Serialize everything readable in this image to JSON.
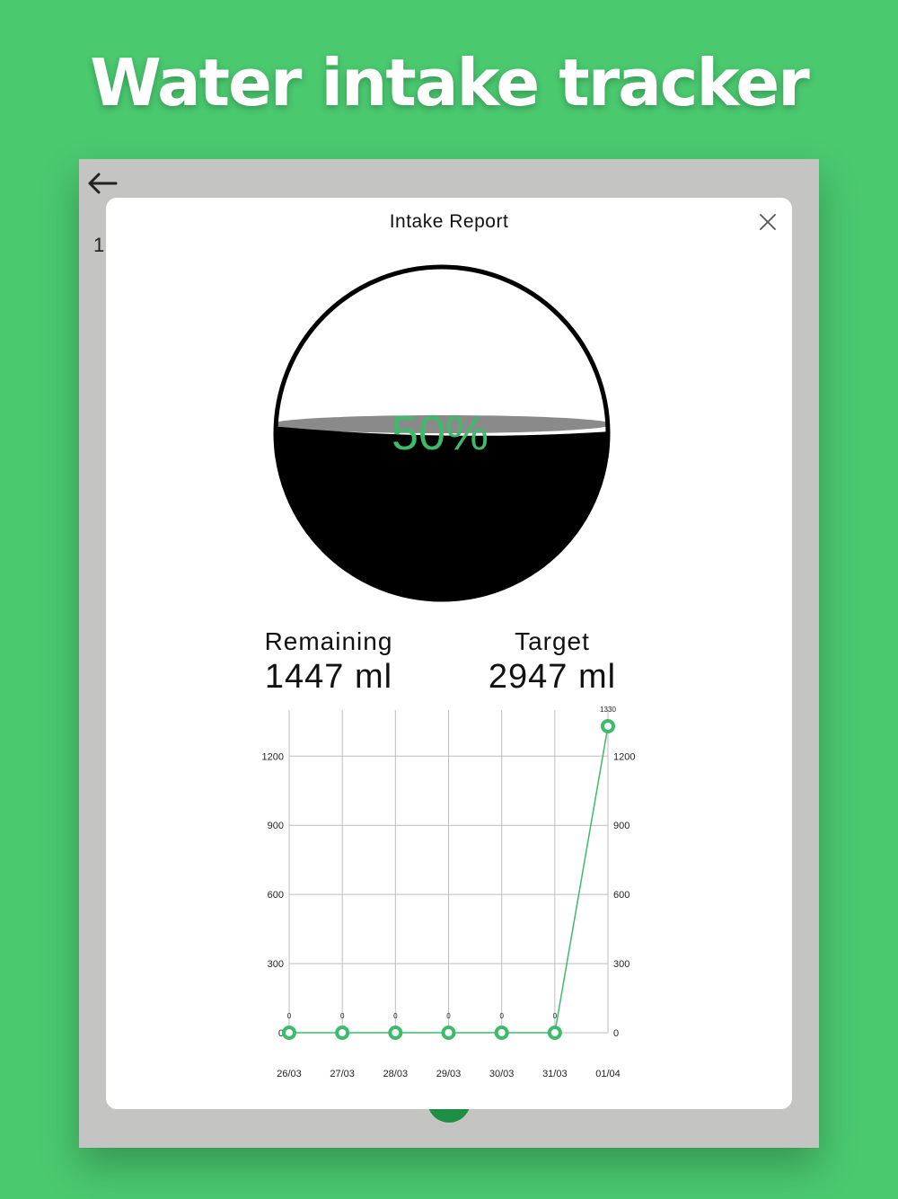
{
  "headline": "Water intake tracker",
  "background_partial_text": "1",
  "modal": {
    "title": "Intake Report",
    "close_icon": "close-icon"
  },
  "gauge": {
    "percent_label": "50%",
    "fill_fraction": 0.5,
    "fill_color": "#000000",
    "text_color": "#3dbb6a"
  },
  "stats": {
    "remaining_label": "Remaining",
    "remaining_value": "1447 ml",
    "target_label": "Target",
    "target_value": "2947 ml"
  },
  "chart_data": {
    "type": "line",
    "categories": [
      "26/03",
      "27/03",
      "28/03",
      "29/03",
      "30/03",
      "31/03",
      "01/04"
    ],
    "series": [
      {
        "values": [
          0,
          0,
          0,
          0,
          0,
          0,
          1330
        ],
        "color": "#3dbb6a"
      }
    ],
    "data_labels": [
      "0",
      "0",
      "0",
      "0",
      "0",
      "0",
      "1330"
    ],
    "y_ticks": [
      0,
      300,
      600,
      900,
      1200
    ],
    "ylim": [
      0,
      1400
    ],
    "grid": true,
    "y_axis_labels_both_sides": true
  },
  "colors": {
    "accent": "#4ac96f",
    "line": "#3dbb6a",
    "dim_backdrop": "#c4c5c3"
  }
}
